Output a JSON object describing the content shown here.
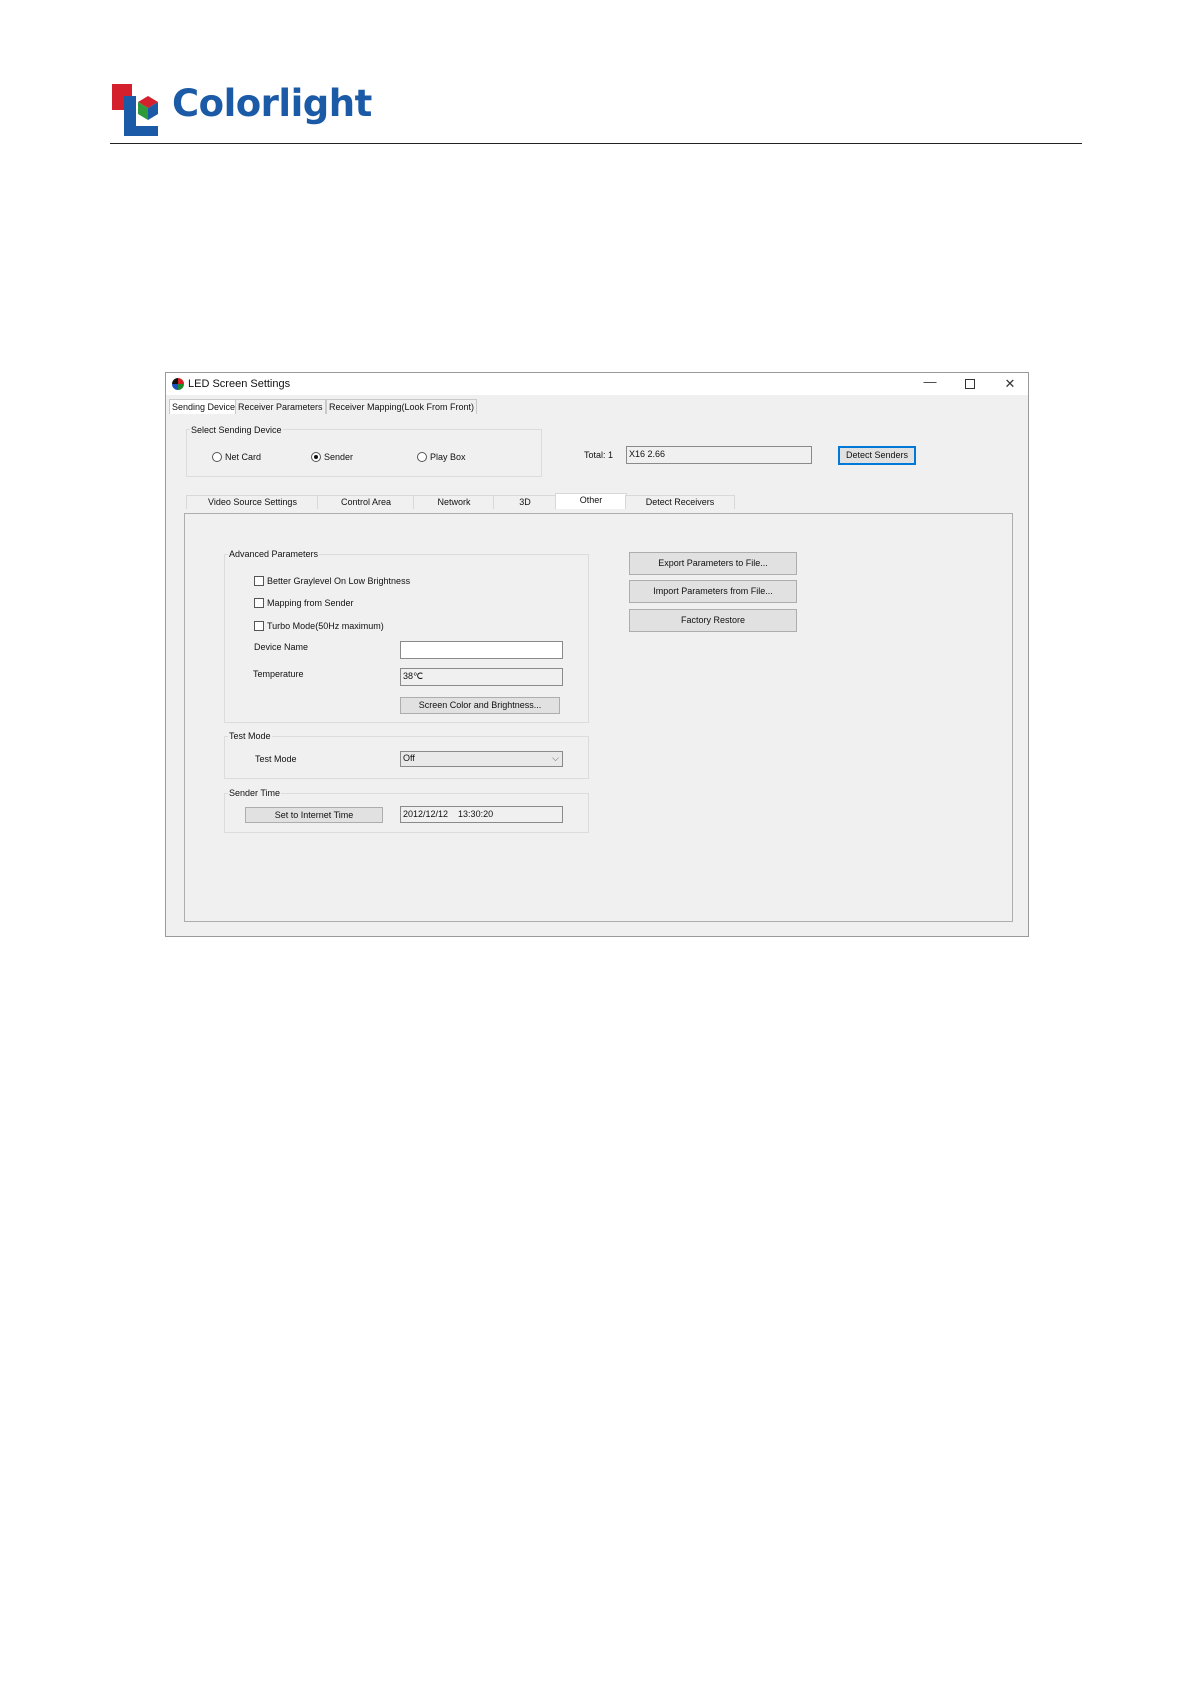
{
  "brand": {
    "logo_text": "Colorlight"
  },
  "window": {
    "title": "LED Screen Settings",
    "controls": {
      "minimize": "—",
      "close": "✕"
    },
    "top_tabs": [
      "Sending Device",
      "Receiver Parameters",
      "Receiver Mapping(Look From Front)"
    ],
    "sending_device": {
      "group_title": "Select Sending Device",
      "options": [
        "Net Card",
        "Sender",
        "Play Box"
      ],
      "selected": "Sender",
      "total_label": "Total:  1",
      "device_value": "X16 2.66",
      "detect_button": "Detect Senders"
    },
    "sub_tabs": [
      "Video Source Settings",
      "Control Area",
      "Network",
      "3D",
      "Other",
      "Detect Receivers"
    ],
    "active_sub_tab": "Other",
    "advanced": {
      "title": "Advanced Parameters",
      "checkboxes": [
        "Better Graylevel On Low Brightness",
        "Mapping from Sender",
        "Turbo Mode(50Hz maximum)"
      ],
      "device_name_label": "Device Name",
      "device_name_value": "",
      "temperature_label": "Temperature",
      "temperature_value": "38℃",
      "color_button": "Screen Color and Brightness..."
    },
    "test_mode": {
      "title": "Test Mode",
      "label": "Test Mode",
      "value": "Off"
    },
    "sender_time": {
      "title": "Sender Time",
      "button": "Set to Internet Time",
      "value": "2012/12/12    13:30:20"
    },
    "file_buttons": [
      "Export Parameters to File...",
      "Import Parameters from File...",
      "Factory Restore"
    ]
  }
}
